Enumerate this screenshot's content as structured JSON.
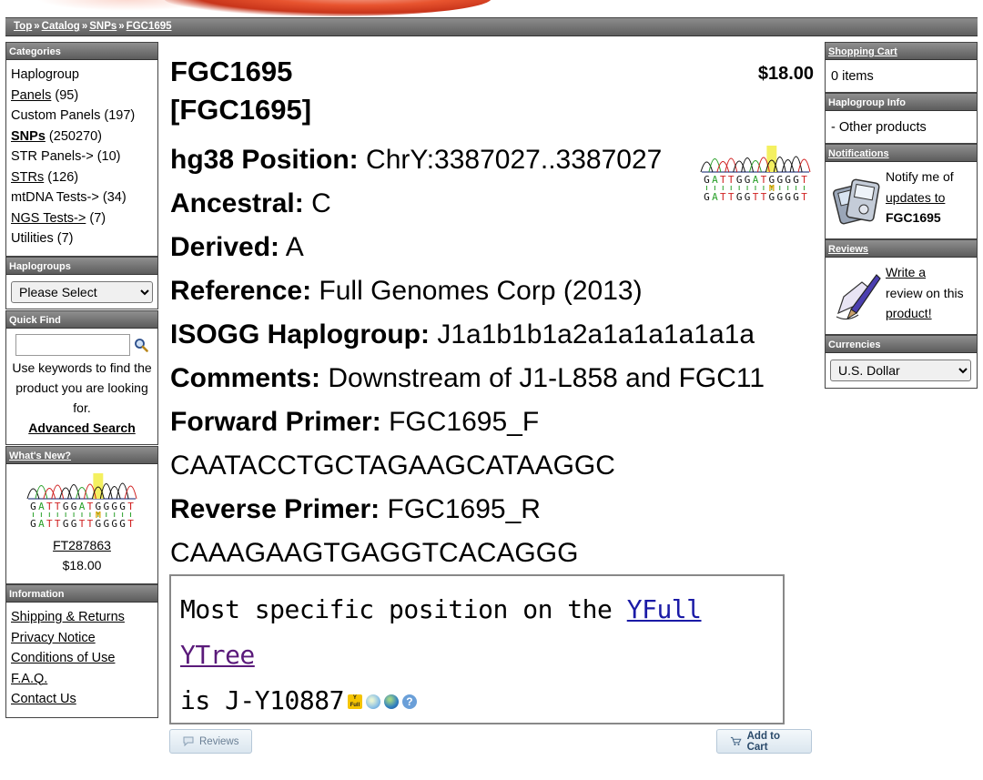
{
  "breadcrumb": {
    "items": [
      "Top",
      "Catalog",
      "SNPs",
      "FGC1695"
    ],
    "sep": "»"
  },
  "categories": {
    "header": "Categories",
    "items": [
      {
        "label": "Haplogroup",
        "count": "",
        "link": false,
        "bold": false
      },
      {
        "label": "Panels",
        "count": "(95)",
        "link": true,
        "bold": false
      },
      {
        "label": "Custom Panels",
        "count": "(197)",
        "link": false,
        "bold": false
      },
      {
        "label": "SNPs",
        "count": "(250270)",
        "link": true,
        "bold": true
      },
      {
        "label": "STR Panels->",
        "count": "(10)",
        "link": false,
        "bold": false
      },
      {
        "label": "STRs",
        "count": "(126)",
        "link": true,
        "bold": false
      },
      {
        "label": "mtDNA Tests->",
        "count": "(34)",
        "link": false,
        "bold": false
      },
      {
        "label": "NGS Tests->",
        "count": "(7)",
        "link": true,
        "bold": false
      },
      {
        "label": "Utilities",
        "count": "(7)",
        "link": false,
        "bold": false
      }
    ]
  },
  "haplogroups": {
    "header": "Haplogroups",
    "selected": "Please Select"
  },
  "quick_find": {
    "header": "Quick Find",
    "help": "Use keywords to find the product you are looking for.",
    "advanced": "Advanced Search"
  },
  "whats_new": {
    "header": "What's New?",
    "product": "FT287863",
    "price": "$18.00"
  },
  "information": {
    "header": "Information",
    "links": [
      "Shipping & Returns",
      "Privacy Notice",
      "Conditions of Use",
      "F.A.Q.",
      "Contact Us"
    ]
  },
  "product": {
    "name": "FGC1695",
    "model": "[FGC1695]",
    "price": "$18.00",
    "fields": [
      {
        "label": "hg38 Position:",
        "value": "ChrY:3387027..3387027"
      },
      {
        "label": "Ancestral:",
        "value": "C"
      },
      {
        "label": "Derived:",
        "value": "A"
      },
      {
        "label": "Reference:",
        "value": "Full Genomes Corp (2013)"
      },
      {
        "label": "ISOGG Haplogroup:",
        "value": "J1a1b1b1a2a1a1a1a1a1a"
      },
      {
        "label": "Comments:",
        "value": "Downstream of J1-L858 and FGC11"
      },
      {
        "label": "Forward Primer:",
        "value": "FGC1695_F"
      },
      {
        "label": "",
        "value": "CAATACCTGCTAGAAGCATAAGGC"
      },
      {
        "label": "Reverse Primer:",
        "value": "FGC1695_R"
      },
      {
        "label": "",
        "value": "CAAAGAAGTGAGGTCACAGGG"
      }
    ]
  },
  "chromatogram": {
    "top_seq": "GATTGGATGGGGT",
    "marker": "M",
    "bottom_seq": "GATTGGTTGGGGT"
  },
  "yfull": {
    "prefix": "Most specific position on the",
    "link1": "YFull",
    "link2": "YTree",
    "line2": "is J-Y10887",
    "icon_text": "Y\nFull",
    "help_glyph": "?"
  },
  "buttons": {
    "reviews": "Reviews",
    "add_to_cart": "Add to Cart"
  },
  "shopping_cart": {
    "header": "Shopping Cart",
    "items": "0 items"
  },
  "haplogroup_info": {
    "header": "Haplogroup Info",
    "item": "Other products"
  },
  "notifications": {
    "header": "Notifications",
    "text1": "Notify me of",
    "link": "updates to",
    "product": "FGC1695"
  },
  "reviews": {
    "header": "Reviews",
    "link1": "Write a",
    "text": "review on this",
    "link2": "product!"
  },
  "currencies": {
    "header": "Currencies",
    "selected": "U.S. Dollar"
  }
}
